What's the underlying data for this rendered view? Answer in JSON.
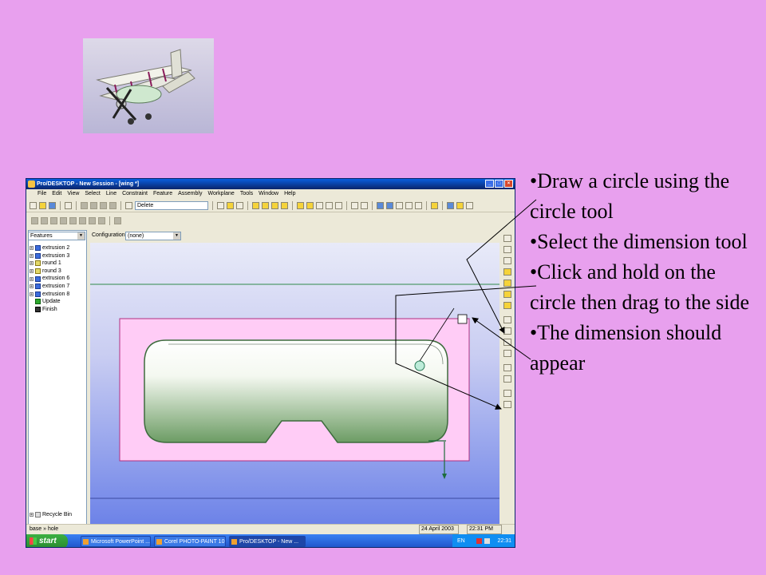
{
  "slide": {
    "bullets": [
      "•Draw a circle using the circle tool",
      "•Select the dimension tool",
      "•Click and hold on the circle then drag to the side",
      "•The dimension should appear"
    ]
  },
  "app": {
    "title": "Pro/DESKTOP - New Session - [wing *]",
    "window_buttons": {
      "minimize": "_",
      "maximize": "□",
      "close": "×"
    },
    "menu": [
      "File",
      "Edit",
      "View",
      "Select",
      "Line",
      "Constraint",
      "Feature",
      "Assembly",
      "Workplane",
      "Tools",
      "Window",
      "Help"
    ],
    "delete_box": "Delete",
    "features_dropdown": "Features",
    "configuration_label": "Configuration:",
    "configuration_value": "(none)",
    "tree": [
      {
        "label": "extrusion 2",
        "icon": "extrusion-icon"
      },
      {
        "label": "extrusion 3",
        "icon": "extrusion-icon"
      },
      {
        "label": "round 1",
        "icon": "round-icon"
      },
      {
        "label": "round 3",
        "icon": "round-icon"
      },
      {
        "label": "extrusion 6",
        "icon": "extrusion-icon"
      },
      {
        "label": "extrusion 7",
        "icon": "extrusion-icon"
      },
      {
        "label": "extrusion 8",
        "icon": "extrusion-icon"
      },
      {
        "label": "Update",
        "icon": "update-arrow-icon"
      },
      {
        "label": "Finish",
        "icon": "finish-flag-icon"
      }
    ],
    "recycle_bin": "Recycle Bin",
    "status": {
      "mode": "base » hole",
      "date": "24 April 2003",
      "time": "22:31 PM"
    }
  },
  "taskbar": {
    "start": "start",
    "tasks": [
      "Microsoft PowerPoint ...",
      "Corel PHOTO-PAINT 10",
      "Pro/DESKTOP - New ..."
    ],
    "language": "EN",
    "clock": "22:31"
  },
  "colors": {
    "slide_bg": "#e8a0ee",
    "profile_fill": "#ffcff8",
    "model_green": "#8fbf8a"
  }
}
